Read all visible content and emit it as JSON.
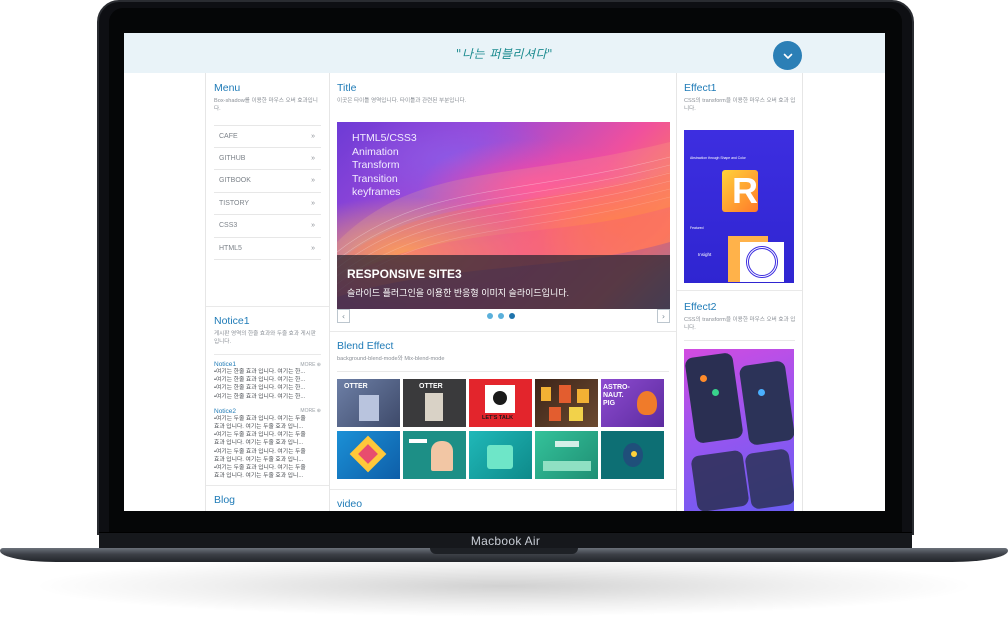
{
  "device": {
    "label": "Macbook Air"
  },
  "header": {
    "slogan": "\"나는 퍼블리셔다\"",
    "toggle_icon": "chevron-down-icon"
  },
  "menu": {
    "title": "Menu",
    "desc": "Box-shadow를 이용한 마우스 오버 효과입니다.",
    "items": [
      {
        "label": "CAFE"
      },
      {
        "label": "GITHUB"
      },
      {
        "label": "GITBOOK"
      },
      {
        "label": "TISTORY"
      },
      {
        "label": "CSS3"
      },
      {
        "label": "HTML5"
      }
    ],
    "chevron": "»"
  },
  "notice": {
    "title": "Notice1",
    "desc": "게시판 영역의 한줄 효과와 두줄 효과 게시판 입니다.",
    "block1": {
      "title": "Notice1",
      "more": "MORE ⊕",
      "lines": [
        "•여기는 한줄 효과 입니다. 여기는 한...",
        "•여기는 한줄 효과 입니다. 여기는 한...",
        "•여기는 한줄 효과 입니다. 여기는 한...",
        "•여기는 한줄 효과 입니다. 여기는 한..."
      ]
    },
    "block2": {
      "title": "Notice2",
      "more": "MORE ⊕",
      "lines": [
        "•여기는 두줄 효과 입니다. 여기는 두줄",
        "  효과 입니다. 여기는 두줄 효과 입니...",
        "•여기는 두줄 효과 입니다. 여기는 두줄",
        "  효과 입니다. 여기는 두줄 효과 입니...",
        "•여기는 두줄 효과 입니다. 여기는 두줄",
        "  효과 입니다. 여기는 두줄 효과 입니...",
        "•여기는 두줄 효과 입니다. 여기는 두줄",
        "  효과 입니다. 여기는 두줄 효과 입니..."
      ]
    }
  },
  "blog": {
    "title": "Blog"
  },
  "main": {
    "title": "Title",
    "desc": "이곳은 타이틀 영역입니다. 타이틀과 관련된 부분입니다.",
    "slider": {
      "words": [
        "HTML5/CSS3",
        "Animation",
        "Transform",
        "Transition",
        "keyframes"
      ],
      "caption_title": "RESPONSIVE SITE3",
      "caption_sub": "슬라이드 플러그인을 이용한 반응형 이미지 슬라이드입니다.",
      "prev": "‹",
      "next": "›",
      "dots": 3,
      "active_dot": 3
    },
    "blend": {
      "title": "Blend Effect",
      "desc": "background-blend-mode와 Mix-blend-mode",
      "thumbs": [
        {
          "text": "OTTER",
          "color": "#5a6a8a"
        },
        {
          "text": "OTTER",
          "color": "#3a3a3c"
        },
        {
          "text": "LET'S TALK",
          "color": "#e3252c"
        },
        {
          "text": "",
          "color": "#4a2f22"
        },
        {
          "text": "ASTRO-NAUT. PIG",
          "color": "#7d3fc0"
        },
        {
          "text": "",
          "color": "#1b90d6"
        },
        {
          "text": "",
          "color": "#1d8f86"
        },
        {
          "text": "",
          "color": "#17a2a2"
        },
        {
          "text": "",
          "color": "#2bb08c"
        },
        {
          "text": "",
          "color": "#0d6f74"
        }
      ]
    },
    "video": {
      "title": "video"
    }
  },
  "effect1": {
    "title": "Effect1",
    "desc": "CSS의 transform을 이용한 마우스 오버 효과 입니다.",
    "img_text_a": "Abstraction through Shape and Color",
    "img_letter": "R",
    "img_text_b": "Featured",
    "img_text_c": "Insight"
  },
  "effect2": {
    "title": "Effect2",
    "desc": "CSS의 transform을 이용한 마우스 오버 효과 입니다."
  }
}
